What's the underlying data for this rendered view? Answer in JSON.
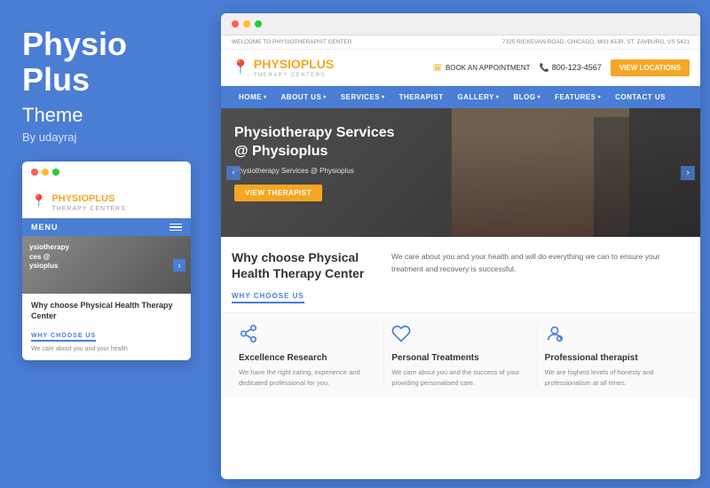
{
  "left": {
    "title": "Physio Plus",
    "subtitle": "Theme",
    "by": "By udayraj"
  },
  "mobile": {
    "brand": "PHYSIO",
    "brand_orange": "PLUS",
    "brand_sub": "THERAPY CENTERS",
    "menu_label": "MENU",
    "hero_text_line1": "ysiotherapy",
    "hero_text_line2": "ces @",
    "hero_text_line3": "ysioplus",
    "why_title": "Why choose Physical Health Therapy Center",
    "why_sub": "WHY CHOOSE US",
    "body_text": "We care about you and your health"
  },
  "topbar": {
    "welcome": "WELCOME TO PHYSIOTHERAPIST CENTER",
    "address": "7325 RICKEVAN ROAD, CHICAGO, M03 43JR, ST. ZAVBURG, VS 5421"
  },
  "header": {
    "brand": "PHYSIO",
    "brand_orange": "PLUS",
    "brand_sub": "THERAPY CENTERS",
    "appointment_label": "BOOK AN APPOINTMENT",
    "phone": "800-123-4567",
    "view_locations": "VIEW LOCATIONS"
  },
  "nav": {
    "items": [
      {
        "label": "HOME"
      },
      {
        "label": "ABOUT US"
      },
      {
        "label": "SERVICES"
      },
      {
        "label": "THERAPIST"
      },
      {
        "label": "GALLERY"
      },
      {
        "label": "BLOG"
      },
      {
        "label": "FEATURES"
      },
      {
        "label": "CONTACT US"
      }
    ]
  },
  "hero": {
    "title": "Physiotherapy Services @ Physioplus",
    "subtitle": "Physiotherapy Services @ Physioplus",
    "btn_label": "VIEW THERAPIST"
  },
  "why": {
    "title": "Why choose Physical Health Therapy Center",
    "sub_label": "WHY CHOOSE US",
    "description": "We care about you and your health and will do everything we can to ensure your treatment and recovery is successful."
  },
  "features": [
    {
      "icon": "share",
      "title": "Excellence Research",
      "desc": "We have the right caring, experience and dedicated professional for you."
    },
    {
      "icon": "heart",
      "title": "Personal Treatments",
      "desc": "We care about you and the success of your providing personalised care."
    },
    {
      "icon": "person",
      "title": "Professional therapist",
      "desc": "We are highest levels of honesty and professionalism at all times."
    }
  ]
}
